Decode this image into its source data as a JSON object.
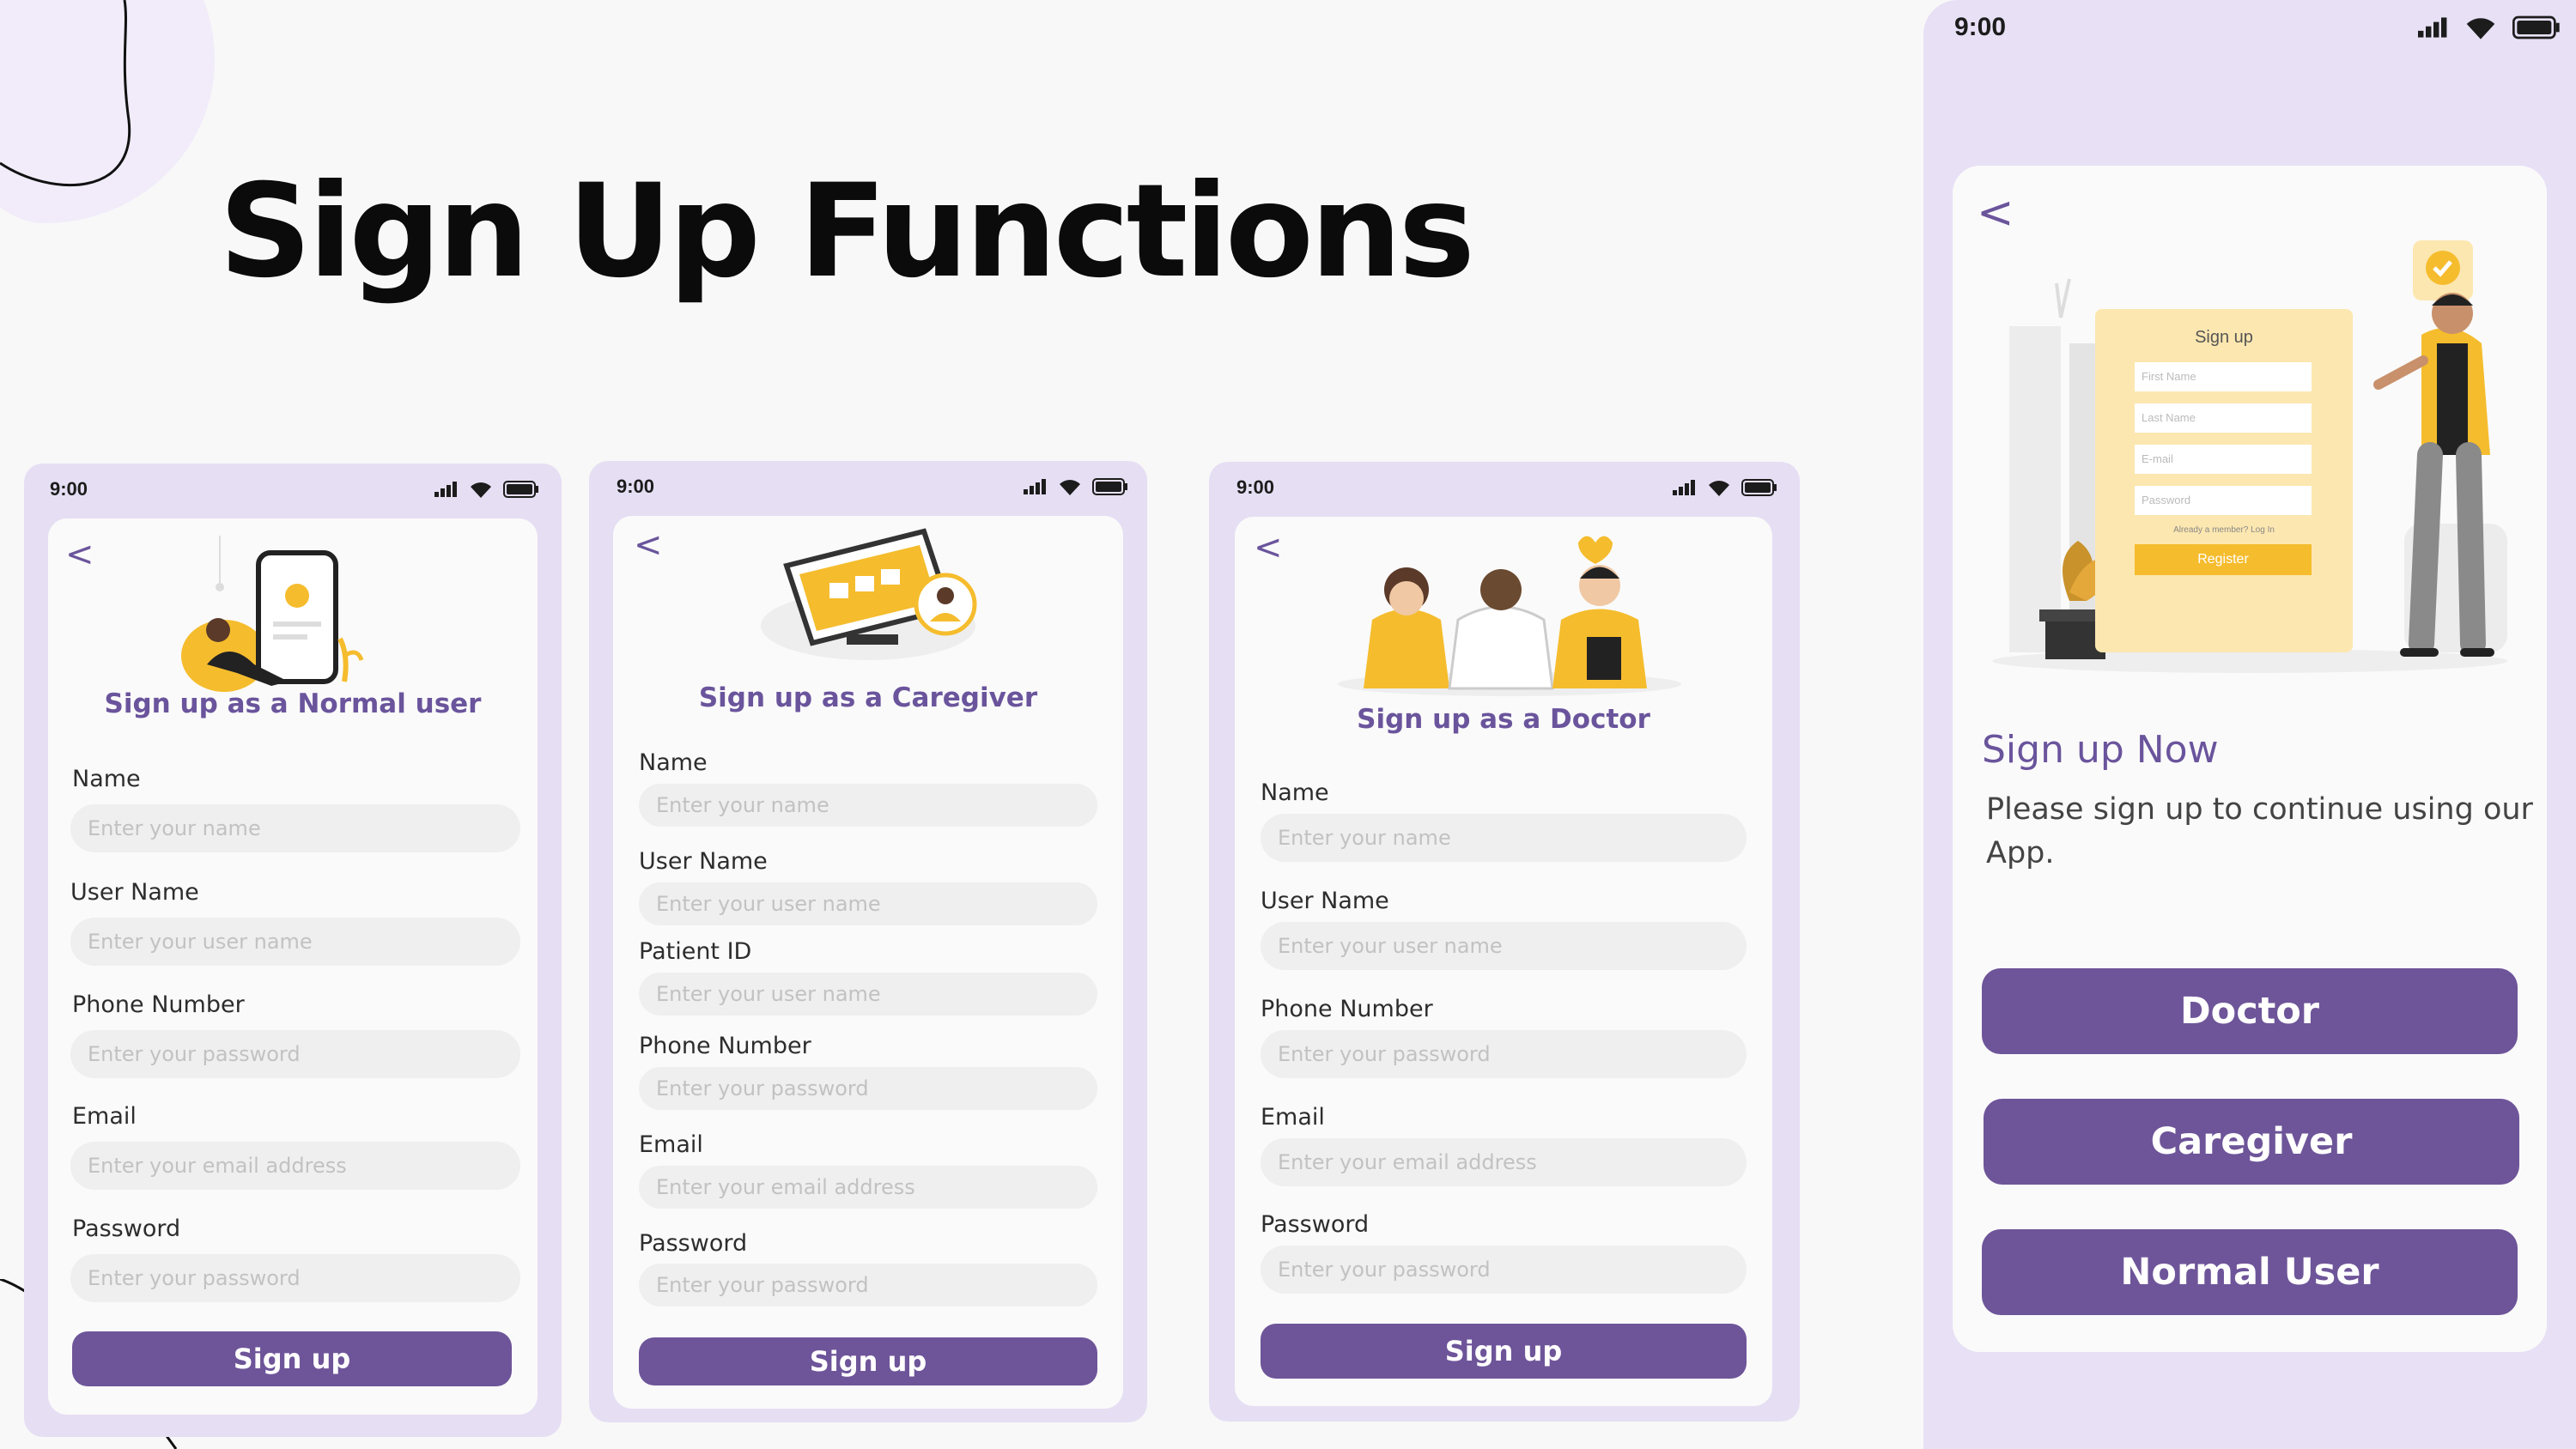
{
  "page": {
    "title": "Sign Up Functions"
  },
  "status_time": "9:00",
  "colors": {
    "accent": "#6e5499",
    "heading": "#6a559d",
    "phone_bg": "#e6dff4",
    "illustration_yellow": "#f5bd2e"
  },
  "screens": [
    {
      "back": "<",
      "heading": "Sign up as a Normal user",
      "fields": [
        {
          "label": "Name",
          "placeholder": "Enter your name"
        },
        {
          "label": "User Name",
          "placeholder": "Enter your user name"
        },
        {
          "label": "Phone Number",
          "placeholder": "Enter your password"
        },
        {
          "label": "Email",
          "placeholder": "Enter your email address"
        },
        {
          "label": "Password",
          "placeholder": "Enter your password"
        }
      ],
      "button": "Sign up"
    },
    {
      "back": "<",
      "heading": "Sign up as a Caregiver",
      "fields": [
        {
          "label": "Name",
          "placeholder": "Enter your name"
        },
        {
          "label": "User Name",
          "placeholder": "Enter your user name"
        },
        {
          "label": "Patient ID",
          "placeholder": "Enter your user name"
        },
        {
          "label": "Phone Number",
          "placeholder": "Enter your password"
        },
        {
          "label": "Email",
          "placeholder": "Enter your email address"
        },
        {
          "label": "Password",
          "placeholder": "Enter your password"
        }
      ],
      "button": "Sign up"
    },
    {
      "back": "<",
      "heading": "Sign up as a Doctor",
      "fields": [
        {
          "label": "Name",
          "placeholder": "Enter your name"
        },
        {
          "label": "User Name",
          "placeholder": "Enter your user name"
        },
        {
          "label": "Phone Number",
          "placeholder": "Enter your password"
        },
        {
          "label": "Email",
          "placeholder": "Enter your email address"
        },
        {
          "label": "Password",
          "placeholder": "Enter your password"
        }
      ],
      "button": "Sign up"
    }
  ],
  "landing": {
    "back": "<",
    "illustration_form": {
      "title": "Sign up",
      "fields": [
        "First Name",
        "Last Name",
        "E-mail",
        "Password"
      ],
      "note": "Already a member? Log In",
      "button": "Register"
    },
    "title": "Sign up Now",
    "description": "Please sign up to continue using our App.",
    "buttons": [
      "Doctor",
      "Caregiver",
      "Normal User"
    ]
  }
}
